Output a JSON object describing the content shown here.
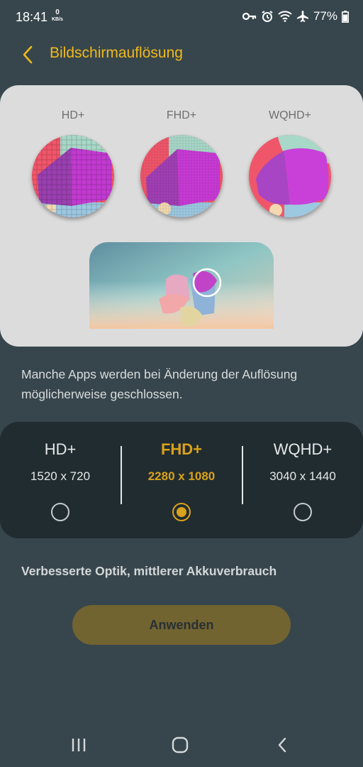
{
  "status_bar": {
    "time": "18:41",
    "net_speed_value": "0",
    "net_speed_unit": "KB/s",
    "battery_text": "77%",
    "icons": [
      "vpn-key-icon",
      "alarm-icon",
      "wifi-icon",
      "airplane-icon",
      "battery-icon"
    ]
  },
  "header": {
    "back_icon": "chevron-left-icon",
    "title": "Bildschirmauflösung"
  },
  "preview": {
    "labels": [
      "HD+",
      "FHD+",
      "WQHD+"
    ]
  },
  "note": "Manche Apps werden bei Änderung der Auflösung möglicherweise geschlossen.",
  "resolutions": [
    {
      "name": "HD+",
      "size": "1520 x 720",
      "selected": false
    },
    {
      "name": "FHD+",
      "size": "2280 x 1080",
      "selected": true
    },
    {
      "name": "WQHD+",
      "size": "3040 x 1440",
      "selected": false
    }
  ],
  "description": "Verbesserte Optik, mittlerer Akkuverbrauch",
  "apply_label": "Anwenden",
  "navbar": {
    "icons": [
      "recents-icon",
      "home-icon",
      "back-icon"
    ]
  },
  "colors": {
    "background": "#37464c",
    "accent": "#f1b91b",
    "selected": "#d9a21b",
    "card_light": "#dcdcdc",
    "card_dark": "#212c30",
    "button": "#716431"
  }
}
